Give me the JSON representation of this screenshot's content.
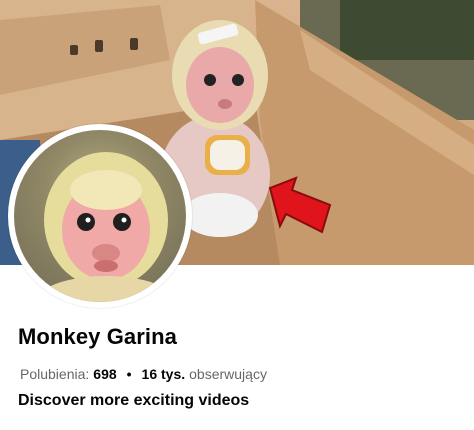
{
  "profile": {
    "name": "Monkey Garina",
    "likes_label": "Polubienia:",
    "likes_value": "698",
    "followers_value": "16 tys.",
    "followers_label": "obserwujący",
    "separator": "•",
    "bio": "Discover more exciting videos"
  },
  "colors": {
    "box": "#c99e74",
    "arrow": "#e0141b",
    "text": "#050505",
    "muted": "#65676b"
  },
  "icons": {
    "cover_arrow": "red-arrow-icon"
  }
}
